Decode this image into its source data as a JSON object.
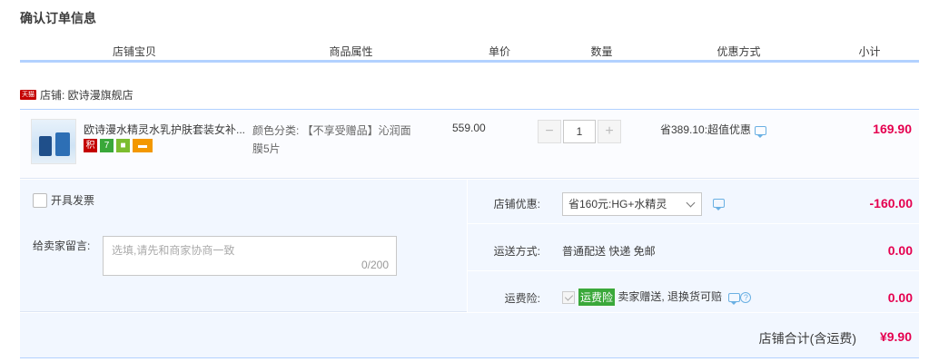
{
  "page_title": "确认订单信息",
  "columns": [
    "店铺宝贝",
    "商品属性",
    "单价",
    "数量",
    "优惠方式",
    "小计"
  ],
  "shop": {
    "icon_text": "天猫",
    "label": "店铺: 欧诗漫旗舰店"
  },
  "item": {
    "title": "欧诗漫水精灵水乳护肤套装女补...",
    "badges": [
      "积",
      "7",
      "",
      ""
    ],
    "attr_line1": "颜色分类: 【不享受赠品】沁润面",
    "attr_line2": "膜5片",
    "unit_price": "559.00",
    "quantity": "1",
    "discount": "省389.10:超值优惠",
    "subtotal": "169.90"
  },
  "invoice": {
    "label": "开具发票"
  },
  "message": {
    "label": "给卖家留言:",
    "placeholder": "选填,请先和商家协商一致",
    "count": "0/200"
  },
  "shop_discount": {
    "label": "店铺优惠:",
    "selected": "省160元:HG+水精灵",
    "amount": "-160.00"
  },
  "shipping": {
    "label": "运送方式:",
    "value": "普通配送 快递 免邮",
    "amount": "0.00"
  },
  "insurance": {
    "label": "运费险:",
    "tag": "运费险",
    "text": "卖家赠送, 退换货可赔",
    "amount": "0.00"
  },
  "total": {
    "label": "店铺合计(含运费)",
    "amount": "¥9.90"
  }
}
